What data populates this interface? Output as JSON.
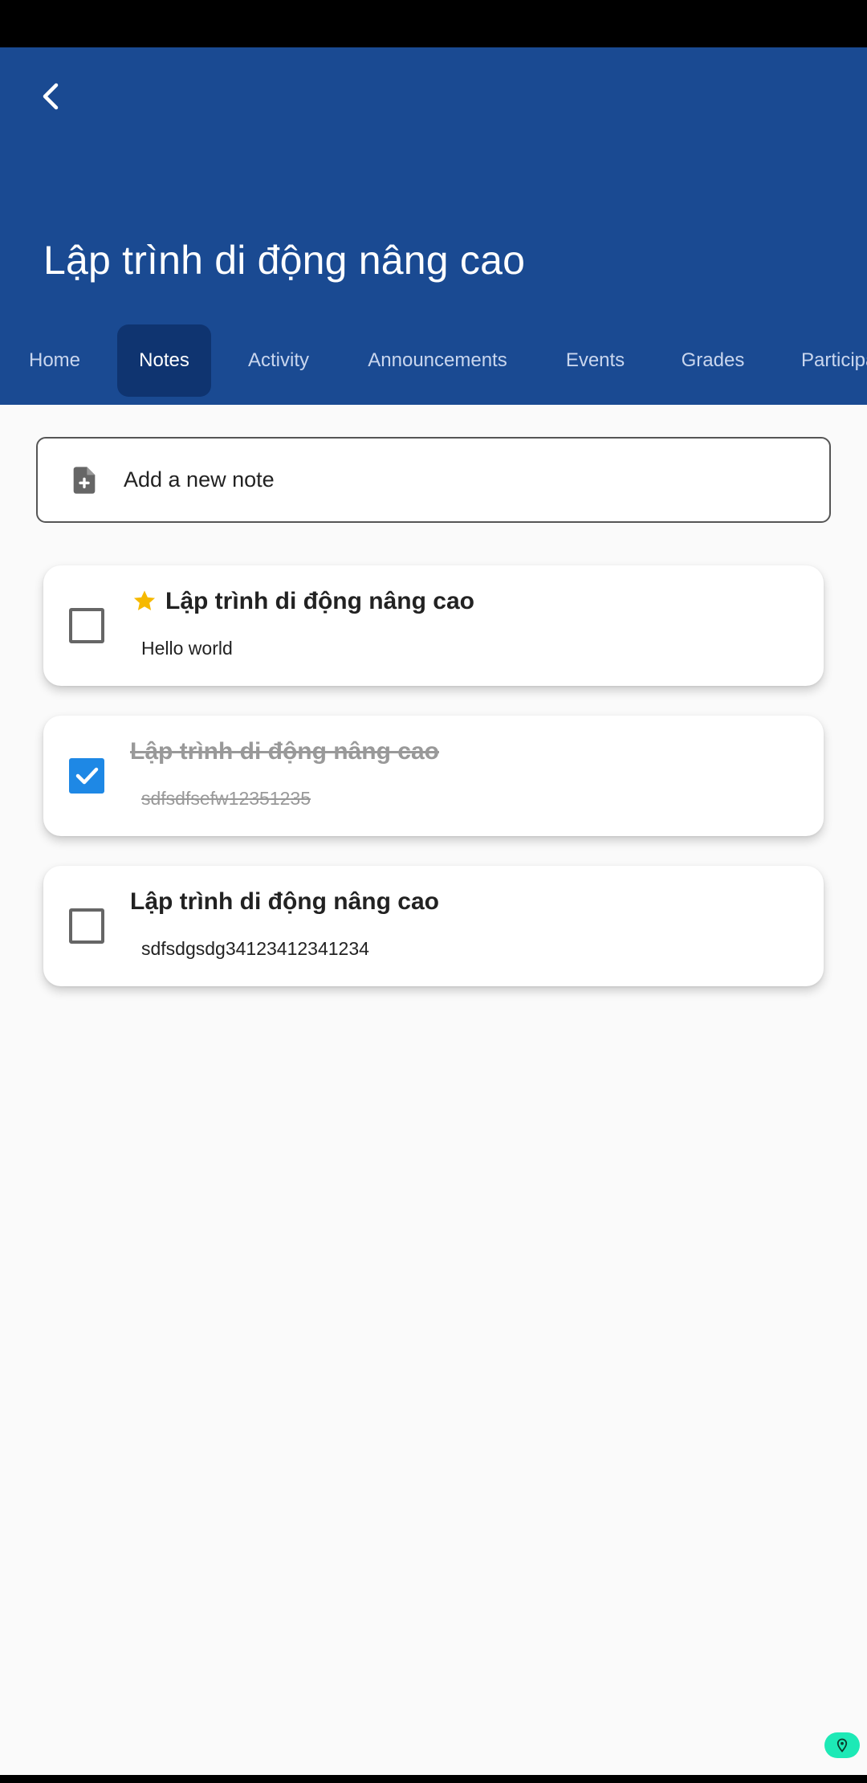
{
  "header": {
    "title": "Lập trình di động nâng cao",
    "back_icon": "chevron-left-icon"
  },
  "tabs": [
    {
      "label": "Home",
      "active": false
    },
    {
      "label": "Notes",
      "active": true
    },
    {
      "label": "Activity",
      "active": false
    },
    {
      "label": "Announcements",
      "active": false
    },
    {
      "label": "Events",
      "active": false
    },
    {
      "label": "Grades",
      "active": false
    },
    {
      "label": "Participa",
      "active": false
    }
  ],
  "add_note": {
    "label": "Add a new note",
    "icon": "note-add-icon"
  },
  "notes": [
    {
      "title": "Lập trình di động nâng cao",
      "body": "Hello world",
      "checked": false,
      "starred": true
    },
    {
      "title": "Lập trình di động nâng cao",
      "body": "sdfsdfsefw12351235",
      "checked": true,
      "starred": false
    },
    {
      "title": "Lập trình di động nâng cao",
      "body": "sdfsdgsdg34123412341234",
      "checked": false,
      "starred": false
    }
  ],
  "colors": {
    "header_bg": "#1a4a92",
    "active_tab_bg": "#0f3470",
    "checkbox_checked": "#1e88e5",
    "star": "#f6b900"
  }
}
